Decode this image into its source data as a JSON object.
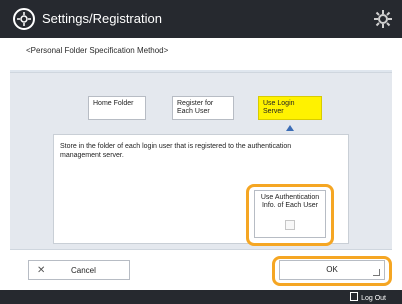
{
  "header": {
    "title": "Settings/Registration",
    "icon": "settings-icon",
    "gear": "gear-icon"
  },
  "subtitle": "<Personal Folder Specification Method>",
  "options": {
    "home": "Home Folder",
    "register_line1": "Register for",
    "register_line2": "Each User",
    "login_line1": "Use Login",
    "login_line2": "Server"
  },
  "description": "Store in the folder of each login user that is registered to the authentication management server.",
  "auth": {
    "line1": "Use Authentication",
    "line2": "Info. of Each User"
  },
  "buttons": {
    "cancel": "Cancel",
    "ok": "OK"
  },
  "footer": {
    "logout": "Log Out"
  },
  "colors": {
    "header_bg": "#26292f",
    "selected": "#fff200",
    "highlight": "#f5a623"
  }
}
